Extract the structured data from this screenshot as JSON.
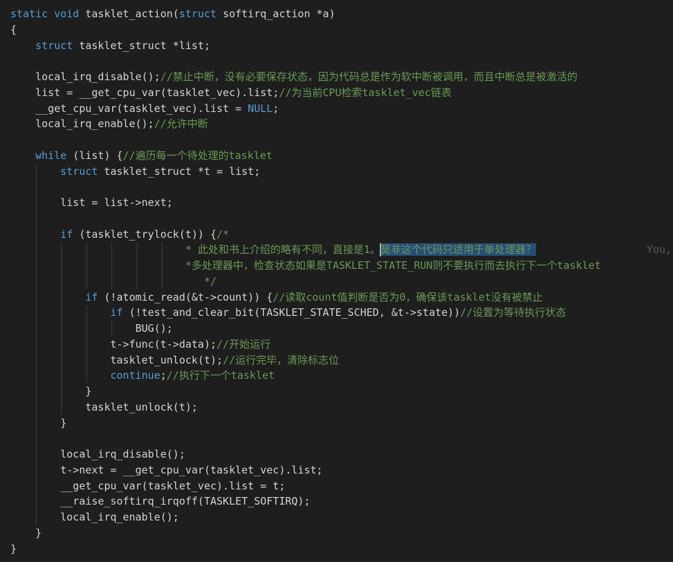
{
  "editor": {
    "theme": {
      "background": "#1e1e1e",
      "keyword": "#569cd6",
      "comment": "#6a9955",
      "text": "#d4d4d4",
      "selection": "#264f78",
      "guide": "#404040"
    },
    "ghost_text": "You,",
    "lines": [
      {
        "indent": 0,
        "tokens": [
          {
            "t": "static void ",
            "c": "k"
          },
          {
            "t": "tasklet_action(",
            "c": "f"
          },
          {
            "t": "struct ",
            "c": "k"
          },
          {
            "t": "softirq_action *a)",
            "c": "f"
          }
        ]
      },
      {
        "indent": 0,
        "tokens": [
          {
            "t": "{",
            "c": "p"
          }
        ]
      },
      {
        "indent": 1,
        "tokens": [
          {
            "t": "struct ",
            "c": "k"
          },
          {
            "t": "tasklet_struct *list;",
            "c": "f"
          }
        ]
      },
      {
        "indent": 1,
        "tokens": []
      },
      {
        "indent": 1,
        "tokens": [
          {
            "t": "local_irq_disable();",
            "c": "f"
          },
          {
            "t": "//禁止中断，没有必要保存状态，因为代码总是作为软中断被调用，而且中断总是被激活的",
            "c": "c"
          }
        ]
      },
      {
        "indent": 1,
        "tokens": [
          {
            "t": "list = __get_cpu_var(tasklet_vec).list;",
            "c": "f"
          },
          {
            "t": "//为当前CPU检索tasklet_vec链表",
            "c": "c"
          }
        ]
      },
      {
        "indent": 1,
        "tokens": [
          {
            "t": "__get_cpu_var(tasklet_vec).list = ",
            "c": "f"
          },
          {
            "t": "NULL",
            "c": "k"
          },
          {
            "t": ";",
            "c": "f"
          }
        ]
      },
      {
        "indent": 1,
        "tokens": [
          {
            "t": "local_irq_enable();",
            "c": "f"
          },
          {
            "t": "//允许中断",
            "c": "c"
          }
        ]
      },
      {
        "indent": 1,
        "tokens": []
      },
      {
        "indent": 1,
        "tokens": [
          {
            "t": "while ",
            "c": "k"
          },
          {
            "t": "(list) {",
            "c": "f"
          },
          {
            "t": "//遍历每一个待处理的tasklet",
            "c": "c"
          }
        ]
      },
      {
        "indent": 2,
        "tokens": [
          {
            "t": "struct ",
            "c": "k"
          },
          {
            "t": "tasklet_struct *t = list;",
            "c": "f"
          }
        ]
      },
      {
        "indent": 2,
        "tokens": []
      },
      {
        "indent": 2,
        "tokens": [
          {
            "t": "list = list->next;",
            "c": "f"
          }
        ]
      },
      {
        "indent": 2,
        "tokens": []
      },
      {
        "indent": 2,
        "tokens": [
          {
            "t": "if ",
            "c": "k"
          },
          {
            "t": "(tasklet_trylock(t)) {",
            "c": "f"
          },
          {
            "t": "/*",
            "c": "c"
          }
        ]
      },
      {
        "indent": 2,
        "pad": "                    ",
        "tokens": [
          {
            "t": "* 此处和书上介绍的略有不同，直接是1。",
            "c": "c"
          },
          {
            "t": "莫非这个代码只适用于单处理器？",
            "c": "c",
            "sel": true
          }
        ],
        "ghost": true
      },
      {
        "indent": 2,
        "pad": "                    ",
        "tokens": [
          {
            "t": "*多处理器中，检查状态如果是TASKLET_STATE_RUN则不要执行而去执行下一个tasklet",
            "c": "c"
          }
        ]
      },
      {
        "indent": 2,
        "pad": "                       ",
        "tokens": [
          {
            "t": "*/",
            "c": "c"
          }
        ]
      },
      {
        "indent": 3,
        "tokens": [
          {
            "t": "if ",
            "c": "k"
          },
          {
            "t": "(!atomic_read(&t->count)) {",
            "c": "f"
          },
          {
            "t": "//读取count值判断是否为0，确保该tasklet没有被禁止",
            "c": "c"
          }
        ]
      },
      {
        "indent": 4,
        "tokens": [
          {
            "t": "if ",
            "c": "k"
          },
          {
            "t": "(!test_and_clear_bit(TASKLET_STATE_SCHED, &t->state))",
            "c": "f"
          },
          {
            "t": "//设置为等待执行状态",
            "c": "c"
          }
        ]
      },
      {
        "indent": 5,
        "tokens": [
          {
            "t": "BUG();",
            "c": "f"
          }
        ]
      },
      {
        "indent": 4,
        "tokens": [
          {
            "t": "t->func(t->data);",
            "c": "f"
          },
          {
            "t": "//开始运行",
            "c": "c"
          }
        ]
      },
      {
        "indent": 4,
        "tokens": [
          {
            "t": "tasklet_unlock(t);",
            "c": "f"
          },
          {
            "t": "//运行完毕，清除标志位",
            "c": "c"
          }
        ]
      },
      {
        "indent": 4,
        "tokens": [
          {
            "t": "continue",
            "c": "k"
          },
          {
            "t": ";",
            "c": "f"
          },
          {
            "t": "//执行下一个tasklet",
            "c": "c"
          }
        ]
      },
      {
        "indent": 3,
        "tokens": [
          {
            "t": "}",
            "c": "p"
          }
        ]
      },
      {
        "indent": 3,
        "tokens": [
          {
            "t": "tasklet_unlock(t);",
            "c": "f"
          }
        ]
      },
      {
        "indent": 2,
        "tokens": [
          {
            "t": "}",
            "c": "p"
          }
        ]
      },
      {
        "indent": 2,
        "tokens": []
      },
      {
        "indent": 2,
        "tokens": [
          {
            "t": "local_irq_disable();",
            "c": "f"
          }
        ]
      },
      {
        "indent": 2,
        "tokens": [
          {
            "t": "t->next = __get_cpu_var(tasklet_vec).list;",
            "c": "f"
          }
        ]
      },
      {
        "indent": 2,
        "tokens": [
          {
            "t": "__get_cpu_var(tasklet_vec).list = t;",
            "c": "f"
          }
        ]
      },
      {
        "indent": 2,
        "tokens": [
          {
            "t": "__raise_softirq_irqoff(TASKLET_SOFTIRQ);",
            "c": "f"
          }
        ]
      },
      {
        "indent": 2,
        "tokens": [
          {
            "t": "local_irq_enable();",
            "c": "f"
          }
        ]
      },
      {
        "indent": 1,
        "tokens": [
          {
            "t": "}",
            "c": "p"
          }
        ]
      },
      {
        "indent": 0,
        "tokens": [
          {
            "t": "}",
            "c": "p"
          }
        ]
      }
    ]
  }
}
